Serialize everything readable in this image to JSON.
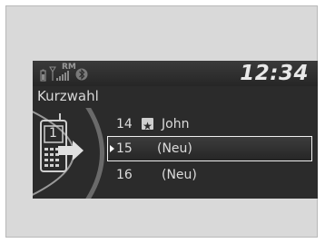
{
  "status": {
    "time": "12:34",
    "roaming_label": "RM",
    "icons": [
      "battery-icon",
      "signal-strength-icon",
      "bluetooth-icon"
    ]
  },
  "screen": {
    "title": "Kurzwahl"
  },
  "phone": {
    "speed_dial_number": "1"
  },
  "list": {
    "items": [
      {
        "number": "14",
        "name": "John",
        "icon": "favorite-star-icon",
        "selected": false
      },
      {
        "number": "15",
        "name": "(Neu)",
        "selected": true
      },
      {
        "number": "16",
        "name": "(Neu)",
        "selected": false
      }
    ]
  },
  "colors": {
    "screen_bg": "#2b2b2b",
    "text": "#dcdcdc",
    "frame_bg": "#d9d9d9"
  }
}
